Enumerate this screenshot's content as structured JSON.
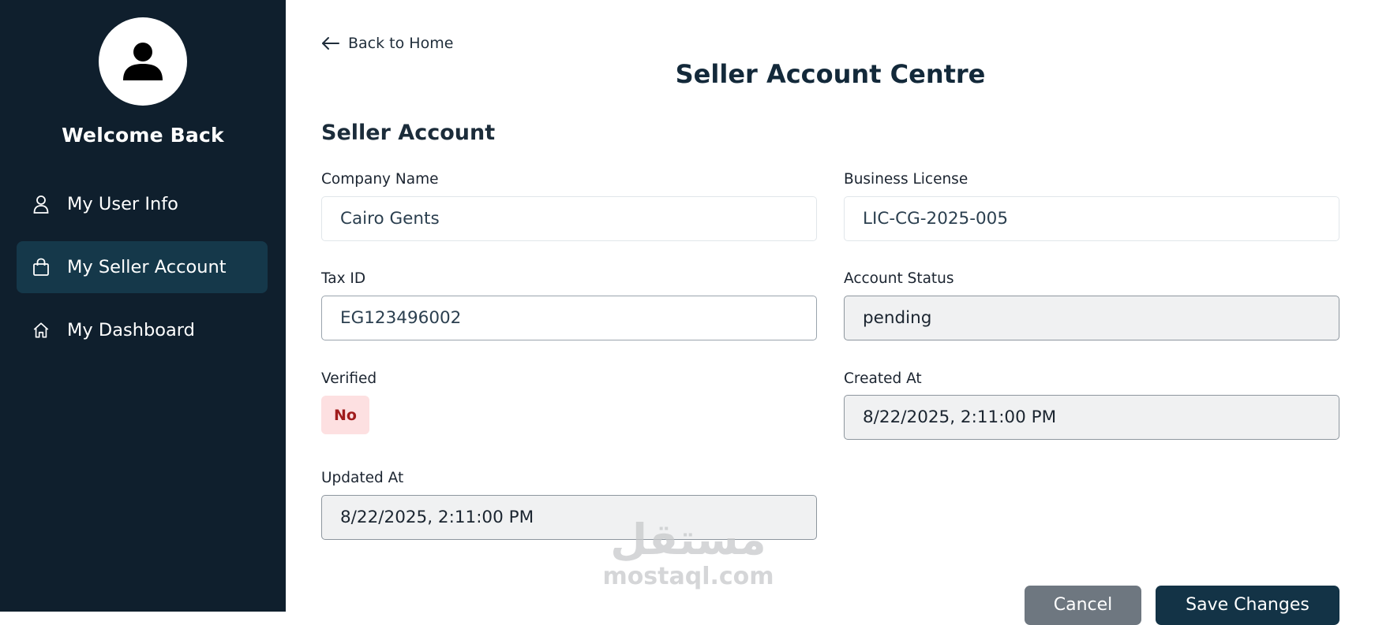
{
  "sidebar": {
    "welcome": "Welcome Back",
    "avatar_icon": "user-silhouette-icon",
    "items": [
      {
        "label": "My User Info",
        "icon": "user-icon",
        "active": false
      },
      {
        "label": "My Seller Account",
        "icon": "shopping-bag-icon",
        "active": true
      },
      {
        "label": "My Dashboard",
        "icon": "home-icon",
        "active": false
      }
    ]
  },
  "header": {
    "back_label": "Back to Home",
    "title": "Seller Account Centre"
  },
  "form": {
    "section_title": "Seller Account",
    "company_name": {
      "label": "Company Name",
      "value": "Cairo Gents"
    },
    "business_license": {
      "label": "Business License",
      "value": "LIC-CG-2025-005"
    },
    "tax_id": {
      "label": "Tax ID",
      "value": "EG123496002"
    },
    "account_status": {
      "label": "Account Status",
      "value": "pending"
    },
    "verified": {
      "label": "Verified",
      "value": "No"
    },
    "created_at": {
      "label": "Created At",
      "value": "8/22/2025, 2:11:00 PM"
    },
    "updated_at": {
      "label": "Updated At",
      "value": "8/22/2025, 2:11:00 PM"
    }
  },
  "actions": {
    "cancel_label": "Cancel",
    "save_label": "Save Changes"
  },
  "watermark": {
    "arabic": "مستقل",
    "url": "mostaql.com"
  },
  "colors": {
    "sidebar_bg": "#0f1f2d",
    "active_item_bg": "#15384a",
    "title_color": "#13293a",
    "badge_bg": "#fde0e1",
    "badge_text": "#a01c1c",
    "cancel_bg": "#6e7780",
    "save_bg": "#133346"
  }
}
